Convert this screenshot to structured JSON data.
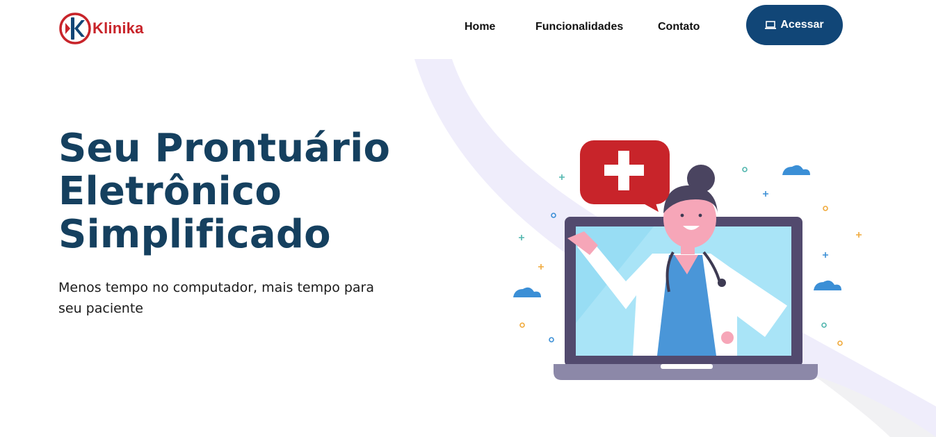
{
  "brand": {
    "name": "Klinika",
    "accent": "#c8242a",
    "mark_color": "#114677"
  },
  "nav": {
    "items": [
      {
        "label": "Home"
      },
      {
        "label": "Funcionalidades"
      },
      {
        "label": "Contato"
      }
    ],
    "cta": {
      "label": "Acessar",
      "icon": "laptop-icon",
      "color": "#114677"
    }
  },
  "hero": {
    "title_lines": [
      "Seu Prontuário",
      "Eletrônico",
      "Simplificado"
    ],
    "subtitle": "Menos tempo no computador, mais tempo para seu paciente",
    "title_color": "#15405f"
  },
  "illustration": {
    "subject": "doctor-in-laptop",
    "icons": [
      "speech-bubble-plus-icon",
      "cloud-icon",
      "sparkle-icon"
    ]
  }
}
